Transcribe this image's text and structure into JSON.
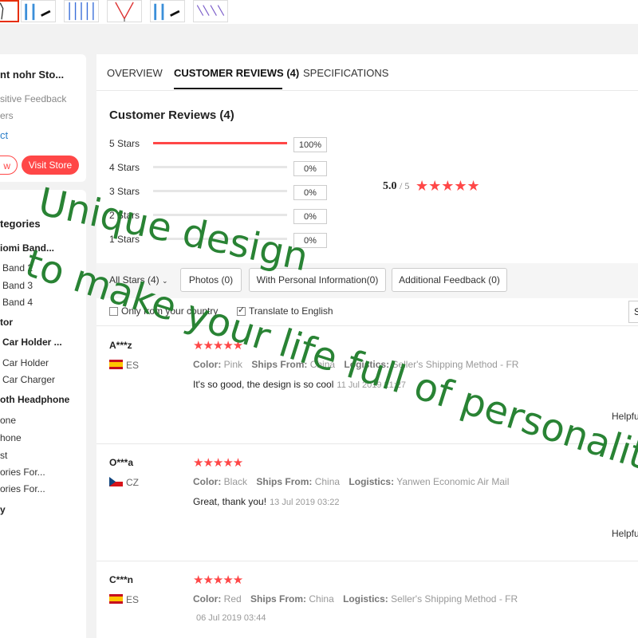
{
  "thumbnails": {
    "items": [
      "thumb-1",
      "thumb-2",
      "thumb-3",
      "thumb-4",
      "thumb-5",
      "thumb-6"
    ]
  },
  "store": {
    "name": "nt nohr Sto...",
    "positive_feedback": "sitive Feedback",
    "followers": "ers",
    "contact": "ct",
    "follow_label": "w",
    "visit_label": "Visit Store"
  },
  "categories": {
    "title": "tegories",
    "items": [
      {
        "label": "iomi Band...",
        "group": true
      },
      {
        "label": "Band 2",
        "group": false
      },
      {
        "label": "Band 3",
        "group": false
      },
      {
        "label": "Band 4",
        "group": false
      },
      {
        "label": "tor",
        "group": true
      },
      {
        "label": "Car Holder ...",
        "group": true
      },
      {
        "label": "Car Holder",
        "group": false
      },
      {
        "label": "Car Charger",
        "group": false
      },
      {
        "label": "oth Headphone",
        "group": true
      },
      {
        "label": "one",
        "group": false
      },
      {
        "label": "hone",
        "group": false
      },
      {
        "label": "st",
        "group": false
      },
      {
        "label": "ories For...",
        "group": false
      },
      {
        "label": "ories For...",
        "group": false
      },
      {
        "label": "y",
        "group": true
      }
    ]
  },
  "tabs": {
    "overview": "OVERVIEW",
    "reviews": "CUSTOMER REVIEWS (4)",
    "specifications": "SPECIFICATIONS"
  },
  "summary": {
    "title": "Customer Reviews (4)",
    "rows": [
      {
        "label": "5 Stars",
        "percent": "100%",
        "fill": 1.0
      },
      {
        "label": "4 Stars",
        "percent": "0%",
        "fill": 0
      },
      {
        "label": "3 Stars",
        "percent": "0%",
        "fill": 0
      },
      {
        "label": "2 Stars",
        "percent": "0%",
        "fill": 0
      },
      {
        "label": "1 Stars",
        "percent": "0%",
        "fill": 0
      }
    ],
    "average": "5.0",
    "out_of": "/ 5",
    "average_stars": 5
  },
  "filters": {
    "all_stars": "All Stars (4)",
    "photos": "Photos (0)",
    "personal_info": "With Personal Information(0)",
    "additional": "Additional Feedback (0)",
    "only_country": "Only from your country",
    "translate": "Translate to English",
    "sort": "S"
  },
  "reviews": [
    {
      "name": "A***z",
      "country": "ES",
      "stars": 5,
      "color_label": "Color:",
      "color": "Pink",
      "ships_label": "Ships From:",
      "ships": "China",
      "logistics_label": "Logistics:",
      "logistics": "Seller's Shipping Method - FR",
      "text": "It's so good, the design is so cool",
      "date": "11 Jul 2019 21:27",
      "helpful": "Helpfu"
    },
    {
      "name": "O***a",
      "country": "CZ",
      "stars": 5,
      "color_label": "Color:",
      "color": "Black",
      "ships_label": "Ships From:",
      "ships": "China",
      "logistics_label": "Logistics:",
      "logistics": "Yanwen Economic Air Mail",
      "text": "Great, thank you!",
      "date": "13 Jul 2019 03:22",
      "helpful": "Helpfu"
    },
    {
      "name": "C***n",
      "country": "ES",
      "stars": 5,
      "color_label": "Color:",
      "color": "Red",
      "ships_label": "Ships From:",
      "ships": "China",
      "logistics_label": "Logistics:",
      "logistics": "Seller's Shipping Method - FR",
      "text": "",
      "date": "06 Jul 2019 03:44",
      "helpful": ""
    }
  ],
  "watermark": {
    "line1": "Unique design",
    "line2": "to make your life full of personality"
  },
  "colors": {
    "accent": "#ff4747",
    "watermark": "#1e7d2a",
    "link": "#2d7fc9"
  }
}
